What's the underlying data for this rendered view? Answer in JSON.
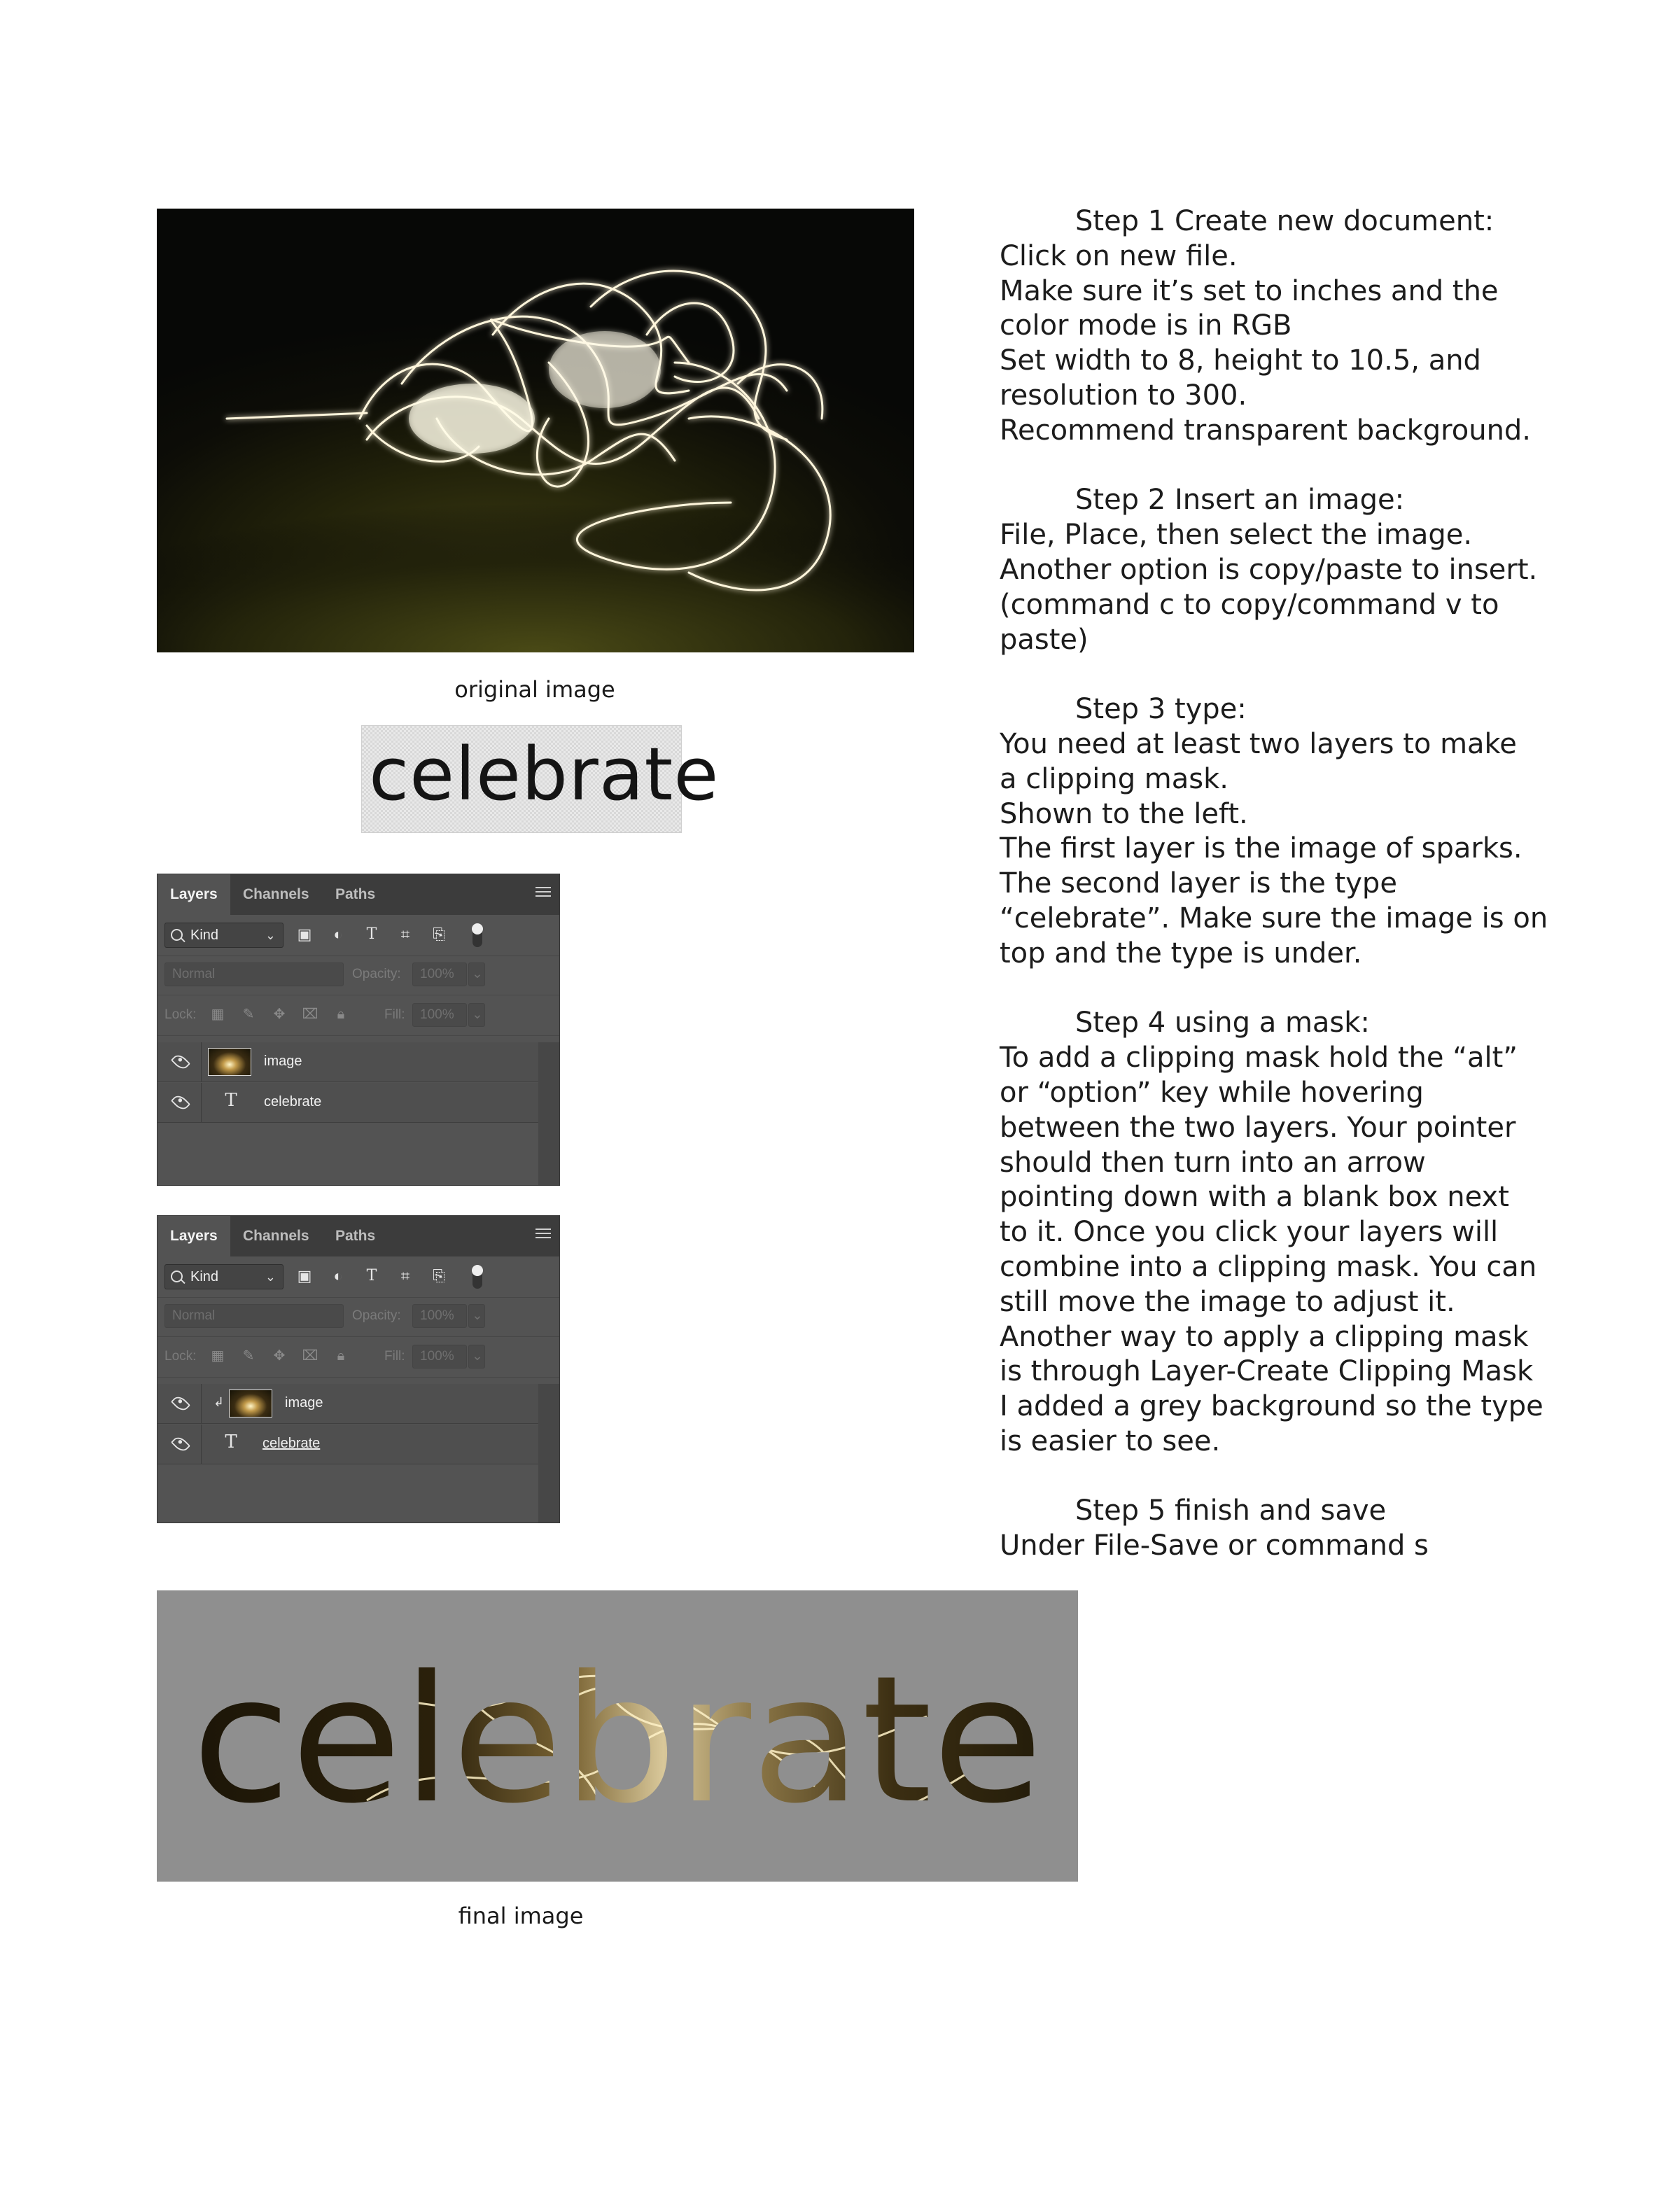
{
  "captions": {
    "original": "original image",
    "final": "final image"
  },
  "type_sample": {
    "text": "celebrate"
  },
  "panel1": {
    "tabs": [
      "Layers",
      "Channels",
      "Paths"
    ],
    "kind": "Kind",
    "blend_mode": "Normal",
    "opacity_label": "Opacity:",
    "opacity_value": "100%",
    "lock_label": "Lock:",
    "fill_label": "Fill:",
    "fill_value": "100%",
    "layers": [
      {
        "name": "image",
        "type": "image"
      },
      {
        "name": "celebrate",
        "type": "text"
      }
    ]
  },
  "panel2": {
    "tabs": [
      "Layers",
      "Channels",
      "Paths"
    ],
    "kind": "Kind",
    "blend_mode": "Normal",
    "opacity_label": "Opacity:",
    "opacity_value": "100%",
    "lock_label": "Lock:",
    "fill_label": "Fill:",
    "fill_value": "100%",
    "layers": [
      {
        "name": "image",
        "type": "image",
        "clipped": true
      },
      {
        "name": "celebrate",
        "type": "text"
      }
    ]
  },
  "steps": [
    {
      "heading": "Step 1 Create new document:",
      "lines": [
        "Click on new file.",
        "Make sure it’s set to inches and the",
        "color mode is in RGB",
        "Set width to 8, height to 10.5, and",
        "resolution to 300.",
        "Recommend transparent background."
      ]
    },
    {
      "heading": "Step 2 Insert an image:",
      "lines": [
        "File, Place, then select the image.",
        "Another option is copy/paste to insert.",
        "(command c to copy/command v to",
        "paste)"
      ]
    },
    {
      "heading": "Step 3 type:",
      "lines": [
        "You need at least two layers to make",
        "a clipping mask.",
        "Shown to the left.",
        "The first layer is the image of sparks.",
        "The second layer is the type",
        "“celebrate”. Make sure the image is on",
        "top and the type is under."
      ]
    },
    {
      "heading": "Step 4 using a mask:",
      "lines": [
        "To add a clipping mask hold the “alt”",
        "or “option” key while hovering",
        "between the two layers. Your pointer",
        "should then turn into an arrow",
        "pointing down with a blank box next",
        "to it. Once you click your layers will",
        "combine into a clipping mask. You can",
        "still move the image to adjust it.",
        "Another way to apply a clipping mask",
        "is through Layer-Create Clipping Mask",
        "I added a grey background so the type",
        "is easier to see."
      ]
    },
    {
      "heading": "Step 5 finish and save",
      "lines": [
        "Under File-Save or command s"
      ]
    }
  ],
  "final_image": {
    "text": "celebrate"
  }
}
